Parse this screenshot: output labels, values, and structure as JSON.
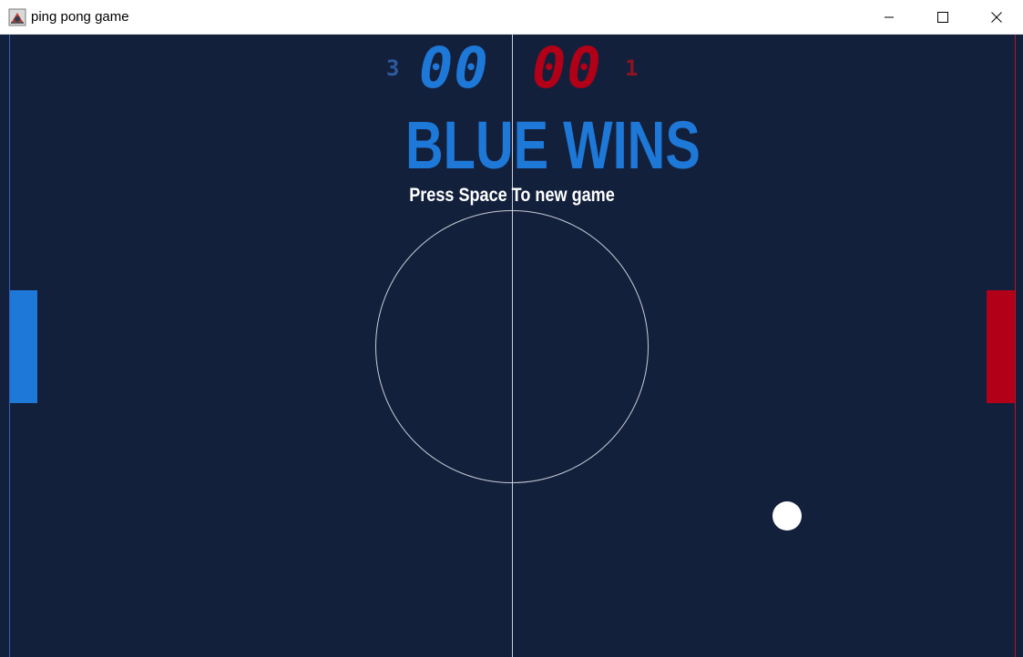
{
  "window": {
    "title": "ping pong game",
    "app_icon": "java-cup-icon",
    "controls": {
      "minimize_icon": "minimize-icon",
      "maximize_icon": "maximize-icon",
      "close_icon": "close-icon"
    }
  },
  "game": {
    "blue": {
      "score": "00",
      "games_won": "3",
      "color": "#1e78d7"
    },
    "red": {
      "score": "00",
      "games_won": "1",
      "color": "#b10017"
    },
    "message": "BLUE WINS",
    "hint": "Press Space To new game",
    "court_color": "#13203c",
    "line_color": "#c8ccd6",
    "ball_color": "#ffffff"
  }
}
